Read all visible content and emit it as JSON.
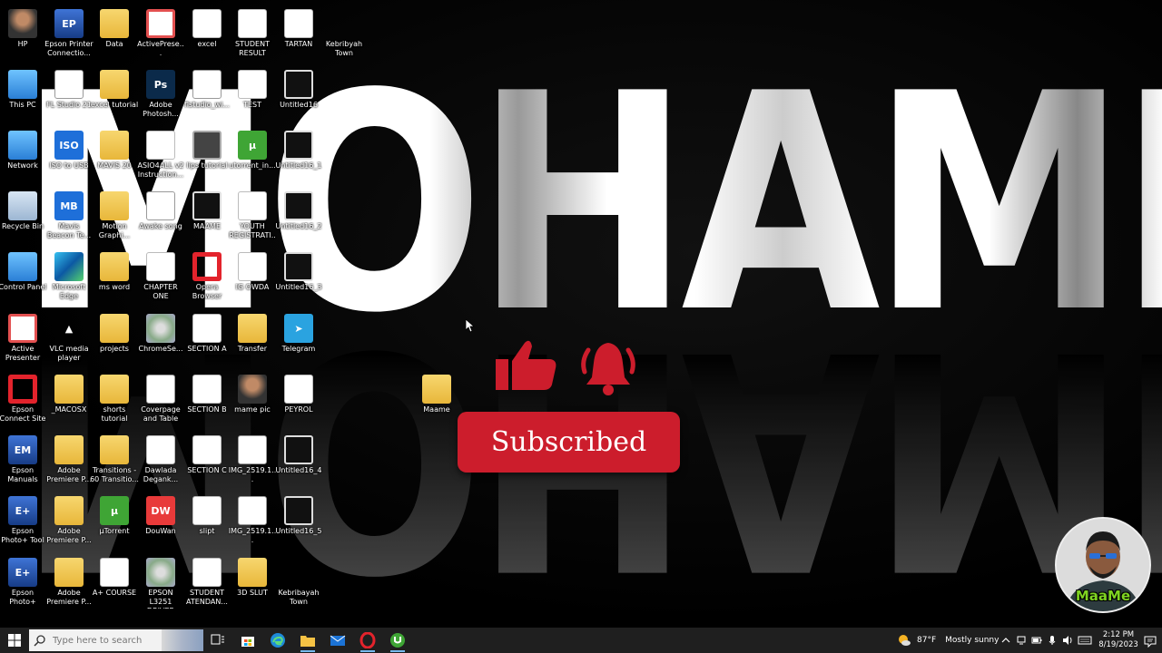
{
  "wallpaper": {
    "text": "MOHAMED"
  },
  "icons": [
    {
      "label": "HP",
      "type": "person"
    },
    {
      "label": "Epson Printer Connectio...",
      "type": "epson",
      "glyph": "EP"
    },
    {
      "label": "Data",
      "type": "folder"
    },
    {
      "label": "ActivePrese...",
      "type": "active",
      "glyph": "a"
    },
    {
      "label": "excel",
      "type": "excel",
      "glyph": "X"
    },
    {
      "label": "STUDENT RESULT",
      "type": "excel",
      "glyph": "X"
    },
    {
      "label": "TARTAN",
      "type": "word",
      "glyph": "W"
    },
    {
      "label": "Kebribyah Town",
      "type": "none"
    },
    {
      "label": "This PC",
      "type": "pc"
    },
    {
      "label": "FL Studio 21",
      "type": "white",
      "glyph": "FL"
    },
    {
      "label": "excel tutorial",
      "type": "folder"
    },
    {
      "label": "Adobe Photosh...",
      "type": "ps",
      "glyph": "Ps"
    },
    {
      "label": "flstudio_wi...",
      "type": "white",
      "glyph": "fl"
    },
    {
      "label": "TEST",
      "type": "word",
      "glyph": "W"
    },
    {
      "label": "Untitled16",
      "type": "film"
    },
    {
      "label": "Network",
      "type": "pc"
    },
    {
      "label": "ISO to USB",
      "type": "blue",
      "glyph": "ISO"
    },
    {
      "label": "MAVIS 20",
      "type": "folder"
    },
    {
      "label": "ASIO4ALL v2 Instruction...",
      "type": "pdf",
      "glyph": "PDF"
    },
    {
      "label": "lips tutorial",
      "type": "cog"
    },
    {
      "label": "utorrent_in...",
      "type": "green",
      "glyph": "µ"
    },
    {
      "label": "Untitled16_1",
      "type": "film"
    },
    {
      "label": "Recycle Bin",
      "type": "recycle"
    },
    {
      "label": "Mavis Beacon Te...",
      "type": "blue",
      "glyph": "MB"
    },
    {
      "label": "Motion Graphi...",
      "type": "folder"
    },
    {
      "label": "Awake song",
      "type": "white",
      "glyph": "▶"
    },
    {
      "label": "MAAME",
      "type": "film"
    },
    {
      "label": "YOUTH REGISTRATI...",
      "type": "word",
      "glyph": "W"
    },
    {
      "label": "Untitled16_2",
      "type": "film"
    },
    {
      "label": "Control Panel",
      "type": "pc"
    },
    {
      "label": "Microsoft Edge",
      "type": "edge"
    },
    {
      "label": "ms word",
      "type": "folder"
    },
    {
      "label": "CHAPTER ONE",
      "type": "pdf",
      "glyph": "PDF"
    },
    {
      "label": "Opera Browser",
      "type": "opera"
    },
    {
      "label": "IG OWDA",
      "type": "word",
      "glyph": "W"
    },
    {
      "label": "Untitled16_3",
      "type": "film"
    },
    {
      "label": "Active Presenter",
      "type": "active",
      "glyph": "a"
    },
    {
      "label": "VLC media player",
      "type": "vlc",
      "glyph": "▲"
    },
    {
      "label": "projects",
      "type": "folder"
    },
    {
      "label": "ChromeSe...",
      "type": "cd"
    },
    {
      "label": "SECTION A",
      "type": "word",
      "glyph": "W"
    },
    {
      "label": "Transfer",
      "type": "folder"
    },
    {
      "label": "Telegram",
      "type": "tele",
      "glyph": "➤"
    },
    {
      "label": "Epson Connect Site",
      "type": "opera"
    },
    {
      "label": "_MACOSX",
      "type": "folder"
    },
    {
      "label": "shorts tutorial",
      "type": "folder"
    },
    {
      "label": "Coverpage and Table",
      "type": "white",
      "glyph": "▬"
    },
    {
      "label": "SECTION B",
      "type": "word",
      "glyph": "W"
    },
    {
      "label": "mame pic",
      "type": "person"
    },
    {
      "label": "PEYROL",
      "type": "excel",
      "glyph": "X"
    },
    {
      "label": "Epson Manuals",
      "type": "epson",
      "glyph": "EM"
    },
    {
      "label": "Adobe Premiere P...",
      "type": "folder"
    },
    {
      "label": "Transitions - 60 Transitio...",
      "type": "folder"
    },
    {
      "label": "Dawlada Degank...",
      "type": "word",
      "glyph": "W"
    },
    {
      "label": "SECTION C",
      "type": "word",
      "glyph": "W"
    },
    {
      "label": "IMG_2519.1...",
      "type": "white",
      "glyph": "▶"
    },
    {
      "label": "Untitled16_4",
      "type": "film"
    },
    {
      "label": "Epson Photo+ Tool",
      "type": "epson",
      "glyph": "E+"
    },
    {
      "label": "Adobe Premiere P...",
      "type": "folder"
    },
    {
      "label": "µTorrent",
      "type": "green",
      "glyph": "µ"
    },
    {
      "label": "DouWan",
      "type": "dou",
      "glyph": "DW"
    },
    {
      "label": "slipt",
      "type": "word",
      "glyph": "W"
    },
    {
      "label": "IMG_2519.1...",
      "type": "white",
      "glyph": "▶"
    },
    {
      "label": "Untitled16_5",
      "type": "film"
    },
    {
      "label": "Epson Photo+",
      "type": "epson",
      "glyph": "E+"
    },
    {
      "label": "Adobe Premiere P...",
      "type": "folder"
    },
    {
      "label": "A+ COURSE",
      "type": "pdf",
      "glyph": "PDF"
    },
    {
      "label": "EPSON L3251 DRIVER",
      "type": "cd"
    },
    {
      "label": "STUDENT ATENDAN...",
      "type": "excel",
      "glyph": "X"
    },
    {
      "label": "3D SLUT",
      "type": "folder"
    },
    {
      "label": "Kebribayah Town",
      "type": "none"
    },
    {
      "label": "Maame",
      "type": "folder"
    }
  ],
  "overlay": {
    "subscribe_label": "Subscribed",
    "like_icon": "thumbs-up-icon",
    "bell_icon": "bell-icon",
    "accent": "#cc1d2c",
    "channel_avatar_name": "MaaMe"
  },
  "taskbar": {
    "search_placeholder": "Type here to search",
    "weather_temp": "87°F",
    "weather_desc": "Mostly sunny",
    "time": "2:12 PM",
    "date": "8/19/2023"
  }
}
